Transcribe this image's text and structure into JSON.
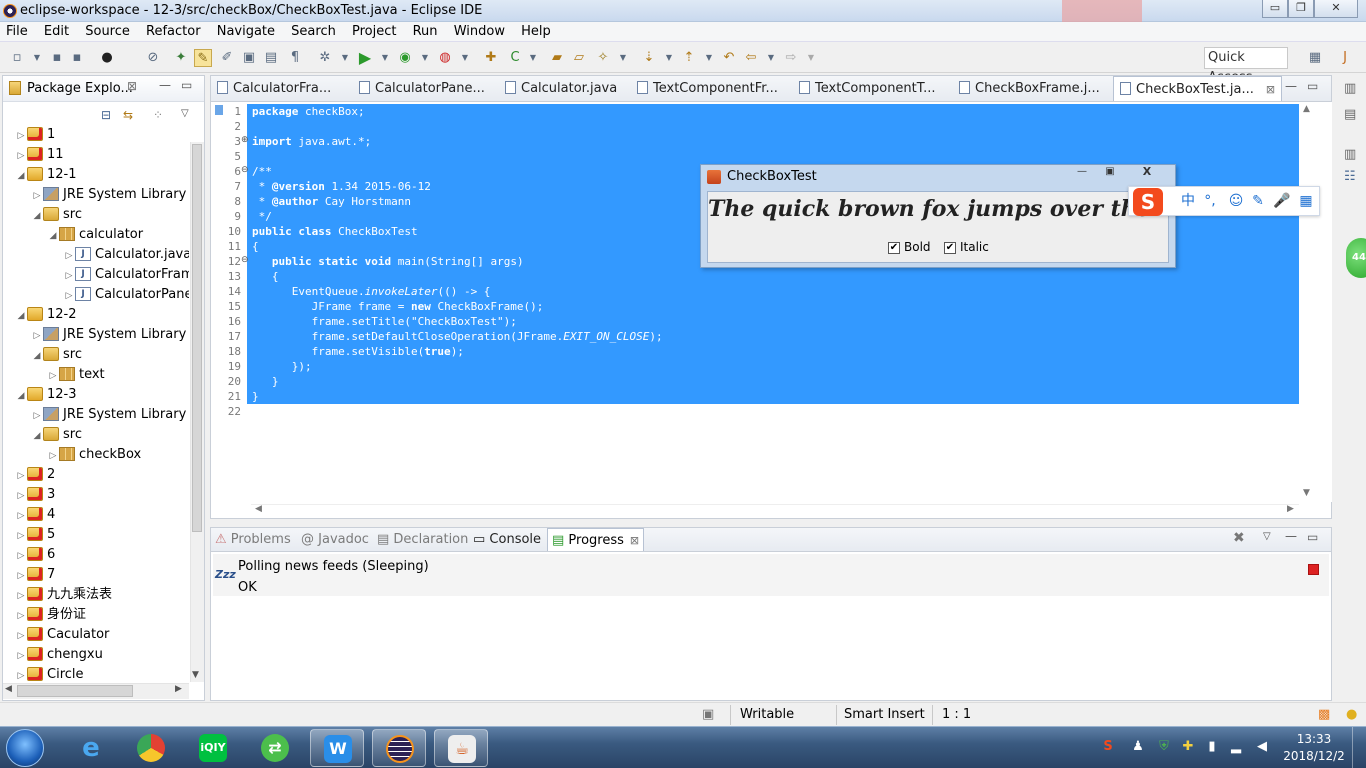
{
  "window": {
    "title": "eclipse-workspace - 12-3/src/checkBox/CheckBoxTest.java - Eclipse IDE",
    "controls": {
      "minimize": "▭",
      "restore": "❐",
      "close": "✕"
    }
  },
  "menu": [
    "File",
    "Edit",
    "Source",
    "Refactor",
    "Navigate",
    "Search",
    "Project",
    "Run",
    "Window",
    "Help"
  ],
  "toolbar": {
    "quick_access_label": "Quick Access"
  },
  "package_explorer": {
    "title": "Package Explo...",
    "tree": [
      {
        "label": "1",
        "type": "project-error",
        "arrow": "▷"
      },
      {
        "label": "11",
        "type": "project-error",
        "arrow": "▷"
      },
      {
        "label": "12-1",
        "type": "project",
        "arrow": "◢"
      },
      {
        "label": "JRE System Library",
        "suffix": "[Ja",
        "type": "lib",
        "arrow": "▷"
      },
      {
        "label": "src",
        "type": "src",
        "arrow": "◢"
      },
      {
        "label": "calculator",
        "type": "pkg",
        "arrow": "◢"
      },
      {
        "label": "Calculator.java",
        "type": "java",
        "arrow": "▷"
      },
      {
        "label": "CalculatorFrame",
        "type": "java",
        "arrow": "▷"
      },
      {
        "label": "CalculatorPanel.j",
        "type": "java",
        "arrow": "▷"
      },
      {
        "label": "12-2",
        "type": "project",
        "arrow": "◢"
      },
      {
        "label": "JRE System Library",
        "suffix": "[Ja",
        "type": "lib",
        "arrow": "▷"
      },
      {
        "label": "src",
        "type": "src",
        "arrow": "◢"
      },
      {
        "label": "text",
        "type": "pkg",
        "arrow": "▷"
      },
      {
        "label": "12-3",
        "type": "project",
        "arrow": "◢"
      },
      {
        "label": "JRE System Library",
        "suffix": "[Ja",
        "type": "lib",
        "arrow": "▷"
      },
      {
        "label": "src",
        "type": "src",
        "arrow": "◢"
      },
      {
        "label": "checkBox",
        "type": "pkg",
        "arrow": "▷"
      },
      {
        "label": "2",
        "type": "project-error",
        "arrow": "▷"
      },
      {
        "label": "3",
        "type": "project-error",
        "arrow": "▷"
      },
      {
        "label": "4",
        "type": "project-error",
        "arrow": "▷"
      },
      {
        "label": "5",
        "type": "project-error",
        "arrow": "▷"
      },
      {
        "label": "6",
        "type": "project-error",
        "arrow": "▷"
      },
      {
        "label": "7",
        "type": "project-error",
        "arrow": "▷"
      },
      {
        "label": "九九乘法表",
        "type": "project-error",
        "arrow": "▷"
      },
      {
        "label": "身份证",
        "type": "project-error",
        "arrow": "▷"
      },
      {
        "label": "Caculator",
        "type": "project-error",
        "arrow": "▷"
      },
      {
        "label": "chengxu",
        "type": "project-error",
        "arrow": "▷"
      },
      {
        "label": "Circle",
        "type": "project-error",
        "arrow": "▷"
      }
    ]
  },
  "editor": {
    "tabs": [
      "CalculatorFra...",
      "CalculatorPane...",
      "Calculator.java",
      "TextComponentFr...",
      "TextComponentT...",
      "CheckBoxFrame.j...",
      "CheckBoxTest.ja..."
    ],
    "active_tab": "CheckBoxTest.ja...",
    "lines": [
      {
        "n": "1",
        "text": "package checkBox;"
      },
      {
        "n": "2",
        "text": ""
      },
      {
        "n": "3",
        "text": "import java.awt.*;"
      },
      {
        "n": "5",
        "text": ""
      },
      {
        "n": "6",
        "text": "/**"
      },
      {
        "n": "7",
        "text": " * @version 1.34 2015-06-12"
      },
      {
        "n": "8",
        "text": " * @author Cay Horstmann"
      },
      {
        "n": "9",
        "text": " */"
      },
      {
        "n": "10",
        "text": "public class CheckBoxTest"
      },
      {
        "n": "11",
        "text": "{"
      },
      {
        "n": "12",
        "text": "   public static void main(String[] args)"
      },
      {
        "n": "13",
        "text": "   {"
      },
      {
        "n": "14",
        "text": "      EventQueue.invokeLater(() -> {"
      },
      {
        "n": "15",
        "text": "         JFrame frame = new CheckBoxFrame();"
      },
      {
        "n": "16",
        "text": "         frame.setTitle(\"CheckBoxTest\");"
      },
      {
        "n": "17",
        "text": "         frame.setDefaultCloseOperation(JFrame.EXIT_ON_CLOSE);"
      },
      {
        "n": "18",
        "text": "         frame.setVisible(true);"
      },
      {
        "n": "19",
        "text": "      });"
      },
      {
        "n": "20",
        "text": "   }"
      },
      {
        "n": "21",
        "text": "}"
      },
      {
        "n": "22",
        "text": ""
      }
    ]
  },
  "checkbox_window": {
    "title": "CheckBoxTest",
    "quote": "The quick brown fox jumps over the lazy dog.",
    "bold": {
      "label": "Bold",
      "checked": true
    },
    "italic": {
      "label": "Italic",
      "checked": true
    }
  },
  "ime_bar": {
    "logo": "S",
    "mode": "中"
  },
  "bottom_panel": {
    "tabs": [
      "Problems",
      "Javadoc",
      "Declaration",
      "Console",
      "Progress"
    ],
    "active_tab": "Progress",
    "job_icon_text": "Zzz",
    "job_title": "Polling news feeds (Sleeping)",
    "job_status": "OK"
  },
  "status_bar": {
    "writable": "Writable",
    "insert_mode": "Smart Insert",
    "position": "1 : 1"
  },
  "right_trim": {
    "badge": "44"
  },
  "taskbar": {
    "time": "13:33",
    "date": "2018/12/2",
    "apps": [
      "ie-icon",
      "chrome-icon",
      "iqiyi-icon",
      "swap-icon",
      "wps-icon",
      "eclipse-icon",
      "java-icon"
    ]
  },
  "colors": {
    "selection": "#3399ff",
    "titlebar": "#c9d9ee"
  }
}
